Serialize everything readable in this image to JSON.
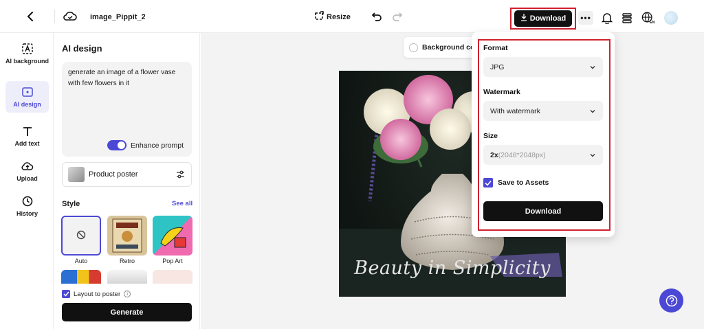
{
  "colors": {
    "accent": "#4c48d6",
    "primary_button": "#111111",
    "highlight_outline": "#d1202f",
    "canvas_bg": "#f3f3f4"
  },
  "topbar": {
    "filename": "image_Pippit_2C",
    "resize_label": "Resize",
    "download_label": "Download",
    "more_label": "•••",
    "icons": [
      "back-arrow-icon",
      "cloud-sync-icon",
      "resize-icon",
      "undo-icon",
      "redo-icon",
      "download-icon",
      "more-icon",
      "bell-icon",
      "layers-icon",
      "language-icon",
      "avatar"
    ]
  },
  "leftnav": {
    "items": [
      {
        "label": "AI background",
        "icon": "ai-background-icon"
      },
      {
        "label": "AI design",
        "icon": "ai-design-icon"
      },
      {
        "label": "Add text",
        "icon": "text-icon"
      },
      {
        "label": "Upload",
        "icon": "upload-cloud-icon"
      },
      {
        "label": "History",
        "icon": "history-clock-icon"
      }
    ]
  },
  "panel": {
    "title": "AI design",
    "prompt": "generate an image of a flower vase with few flowers in it",
    "enhance_label": "Enhance prompt",
    "product_poster_label": "Product poster",
    "style_label": "Style",
    "see_all": "See all",
    "styles": [
      {
        "name": "Auto"
      },
      {
        "name": "Retro"
      },
      {
        "name": "Pop Art"
      }
    ],
    "layout_label": "Layout to poster",
    "generate_label": "Generate"
  },
  "canvas": {
    "bg_chip_label": "Background co",
    "caption": "Beauty in Simplicity"
  },
  "download_panel": {
    "format_label": "Format",
    "format_value": "JPG",
    "watermark_label": "Watermark",
    "watermark_value": "With watermark",
    "size_label": "Size",
    "size_value": "2x",
    "size_sub": "(2048*2048px)",
    "save_label": "Save to Assets",
    "download_button": "Download"
  }
}
